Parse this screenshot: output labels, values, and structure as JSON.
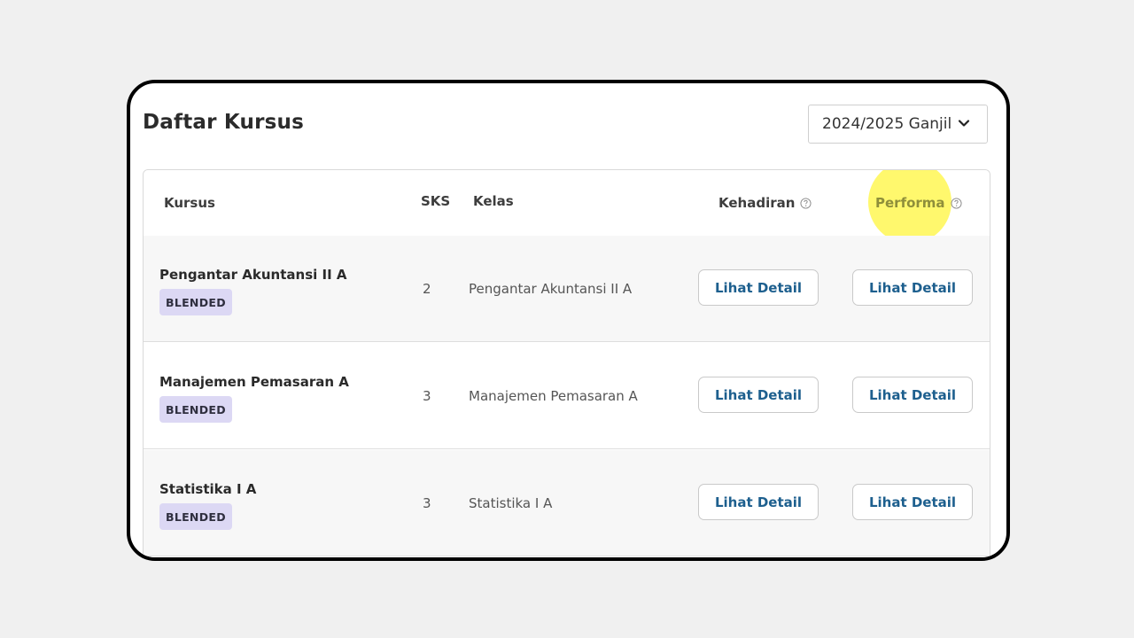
{
  "page": {
    "title": "Daftar Kursus"
  },
  "semester_select": {
    "value": "2024/2025 Ganjil"
  },
  "table": {
    "headers": {
      "kursus": "Kursus",
      "sks": "SKS",
      "kelas": "Kelas",
      "kehadiran": "Kehadiran",
      "performa": "Performa"
    },
    "rows": [
      {
        "course": "Pengantar Akuntansi II A",
        "badge": "BLENDED",
        "sks": "2",
        "kelas": "Pengantar Akuntansi II A",
        "kehadiran_button": "Lihat Detail",
        "performa_button": "Lihat Detail"
      },
      {
        "course": "Manajemen Pemasaran A",
        "badge": "BLENDED",
        "sks": "3",
        "kelas": "Manajemen Pemasaran A",
        "kehadiran_button": "Lihat Detail",
        "performa_button": "Lihat Detail"
      },
      {
        "course": "Statistika I A",
        "badge": "BLENDED",
        "sks": "3",
        "kelas": "Statistika I A",
        "kehadiran_button": "Lihat Detail",
        "performa_button": "Lihat Detail"
      }
    ]
  },
  "colors": {
    "accent": "#1d5f8e",
    "badge_bg": "#dcd8f4",
    "highlight": "#fff53c",
    "highlighted_header_text": "#8f8f3a"
  },
  "icons": {
    "select": "chevron-down-icon",
    "help": "help-circle-icon"
  }
}
